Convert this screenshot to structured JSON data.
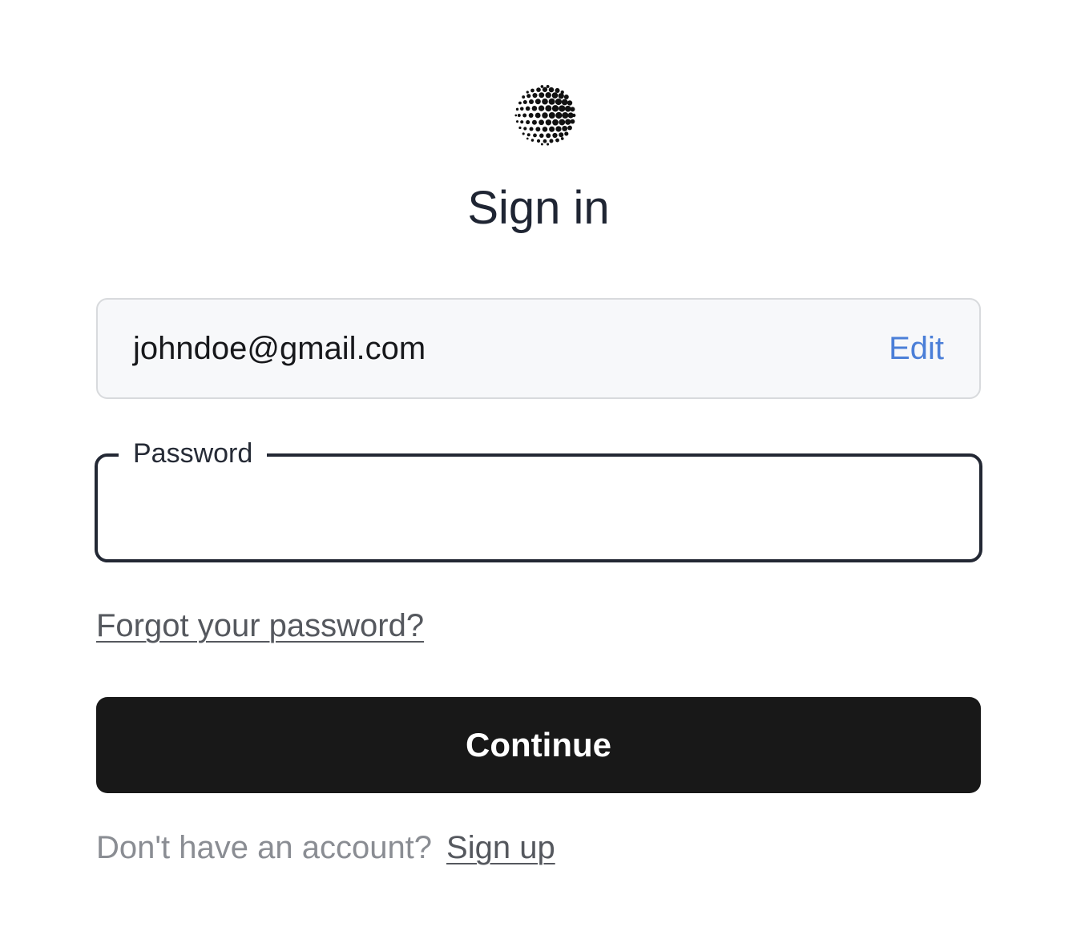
{
  "logo": {
    "icon": "dotted-sphere-logo-icon",
    "color": "#111111"
  },
  "title": "Sign in",
  "email": {
    "value": "johndoe@gmail.com",
    "edit_label": "Edit",
    "accent_color": "#4b7fd8"
  },
  "password": {
    "label": "Password",
    "value": ""
  },
  "forgot_password": "Forgot your password?",
  "continue_label": "Continue",
  "signup": {
    "prompt": "Don't have an account?",
    "link": "Sign up"
  }
}
